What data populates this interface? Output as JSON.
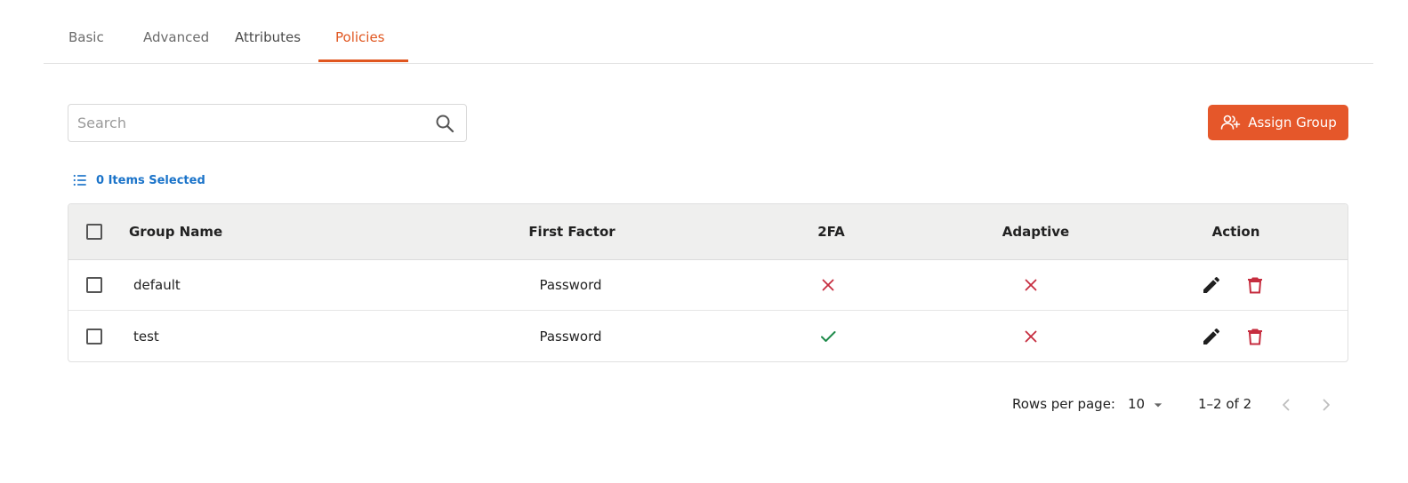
{
  "tabs": [
    {
      "label": "Basic",
      "active": false
    },
    {
      "label": "Advanced",
      "active": false
    },
    {
      "label": "Attributes",
      "active": false
    },
    {
      "label": "Policies",
      "active": true
    }
  ],
  "colors": {
    "accent": "#e0561f",
    "button": "#e5572a",
    "link": "#1a73c9",
    "check_green": "#1e8a4a",
    "cross_red": "#c62d3f",
    "delete_red": "#c62d3f"
  },
  "search": {
    "placeholder": "Search",
    "value": "",
    "icon": "search-icon"
  },
  "assign_button": {
    "label": "Assign Group",
    "icon": "person-add-icon"
  },
  "selection": {
    "label": "0 Items Selected",
    "icon": "list-icon"
  },
  "table": {
    "headers": {
      "group_name": "Group Name",
      "first_factor": "First Factor",
      "two_fa": "2FA",
      "adaptive": "Adaptive",
      "action": "Action"
    },
    "rows": [
      {
        "group_name": "default",
        "first_factor": "Password",
        "two_fa": false,
        "adaptive": false
      },
      {
        "group_name": "test",
        "first_factor": "Password",
        "two_fa": true,
        "adaptive": false
      }
    ]
  },
  "pagination": {
    "rows_per_page_label": "Rows per page:",
    "rows_per_page": "10",
    "range": "1–2 of 2"
  }
}
